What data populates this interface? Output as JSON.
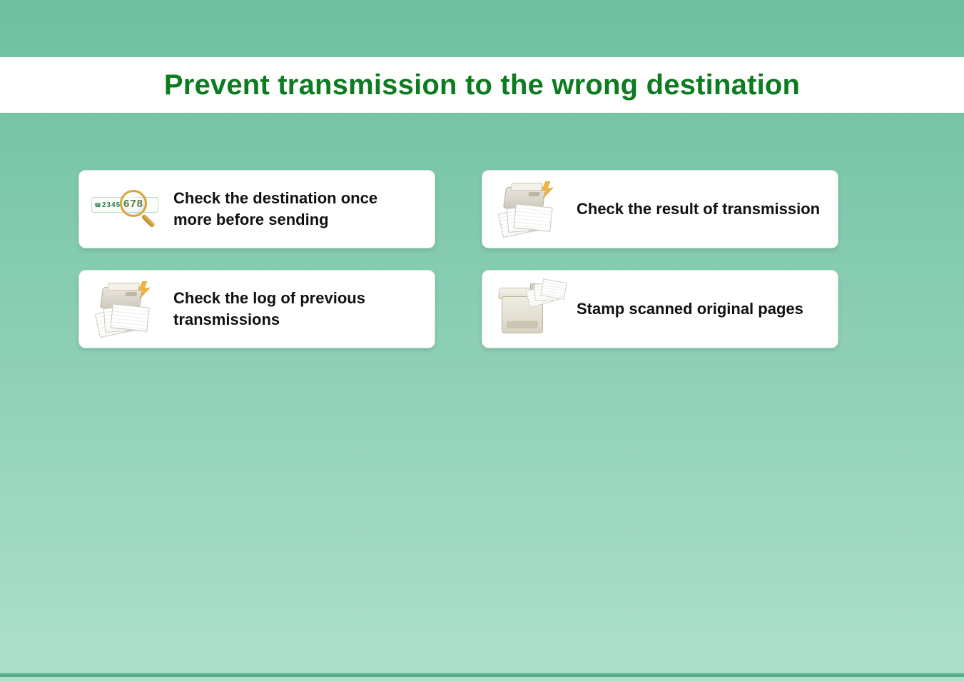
{
  "title": "Prevent transmission to the wrong destination",
  "display_digits": "2345",
  "display_zoom_digits": "678",
  "cards": [
    {
      "label": "Check the destination once more before sending",
      "icon": "magnifier-display-icon"
    },
    {
      "label": "Check the result of transmission",
      "icon": "fax-stack-icon"
    },
    {
      "label": "Check the log of previous transmissions",
      "icon": "fax-stack-icon"
    },
    {
      "label": "Stamp scanned original pages",
      "icon": "copier-output-icon"
    }
  ]
}
